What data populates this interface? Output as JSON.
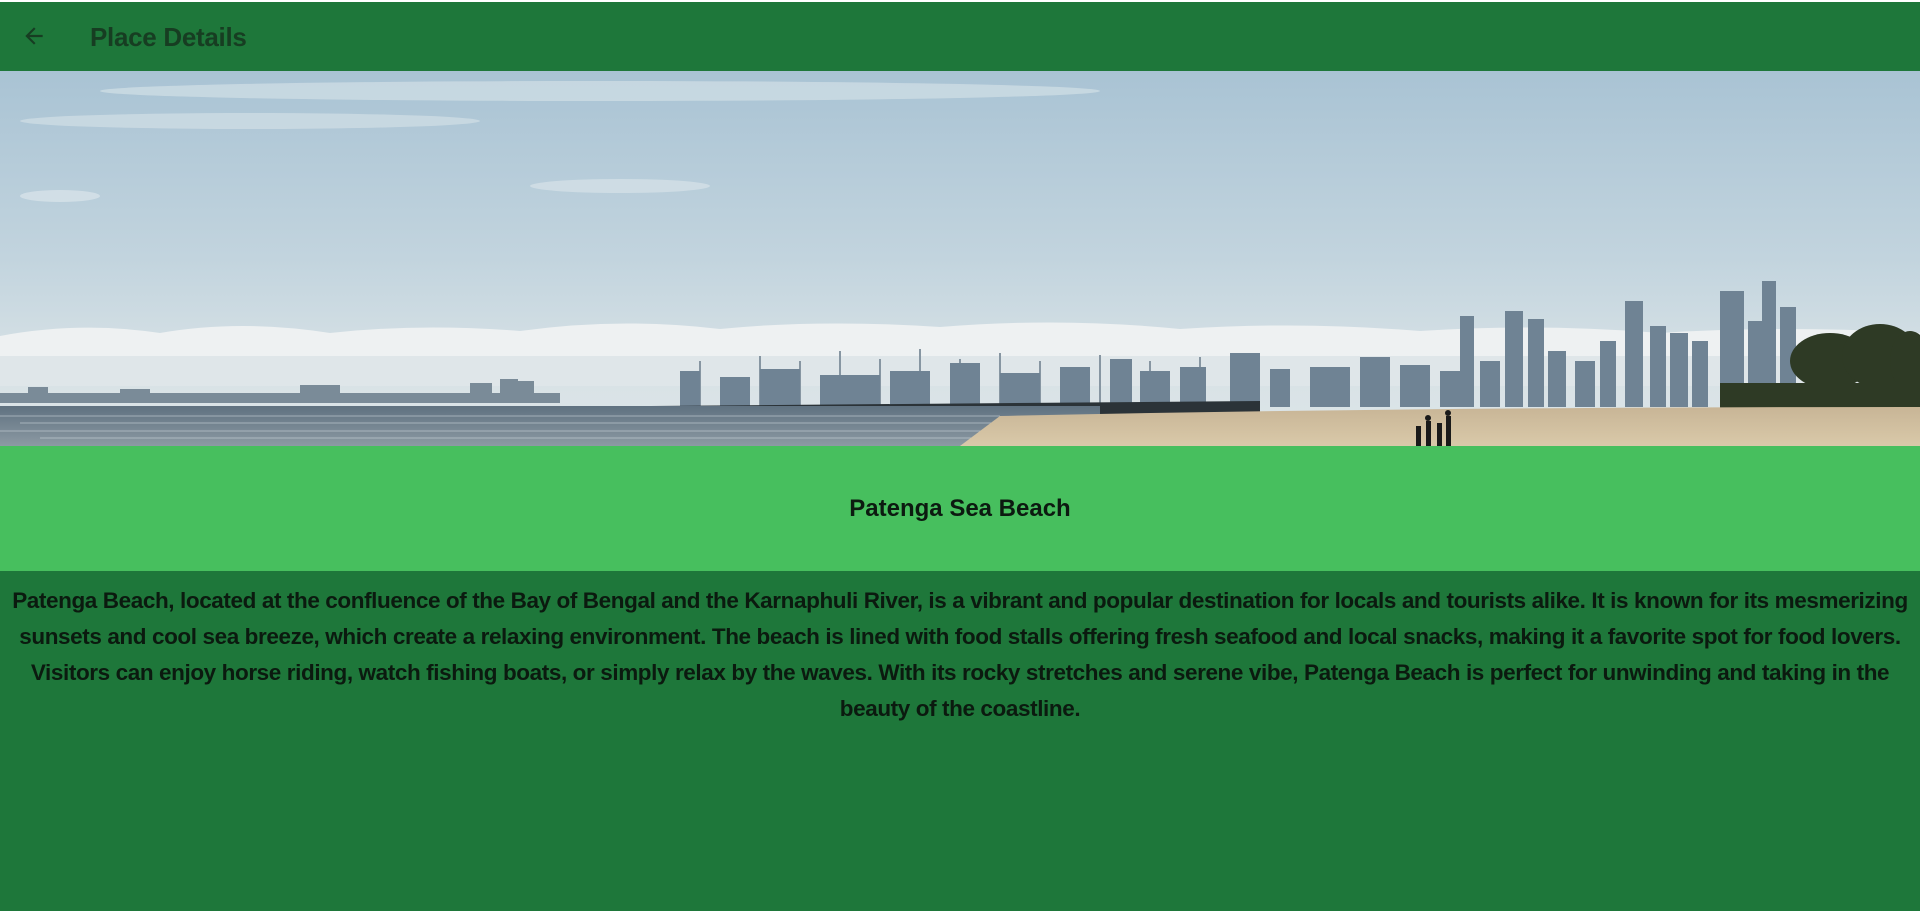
{
  "header": {
    "back_icon": "arrow-left-icon",
    "title": "Place Details"
  },
  "hero": {
    "image_subject": "city skyline across the water viewed from a beach"
  },
  "place": {
    "name": "Patenga Sea Beach",
    "description": "Patenga Beach, located at the confluence of the Bay of Bengal and the Karnaphuli River, is a vibrant and popular destination for locals and tourists alike. It is known for its mesmerizing sunsets and cool sea breeze, which create a relaxing environment. The beach is lined with food stalls offering fresh seafood and local snacks, making it a favorite spot for food lovers. Visitors can enjoy horse riding, watch fishing boats, or simply relax by the waves. With its rocky stretches and serene vibe, Patenga Beach is perfect for unwinding and taking in the beauty of the coastline."
  },
  "colors": {
    "app_bar": "#1e773a",
    "name_band": "#47bf5e",
    "background": "#1e773a"
  }
}
